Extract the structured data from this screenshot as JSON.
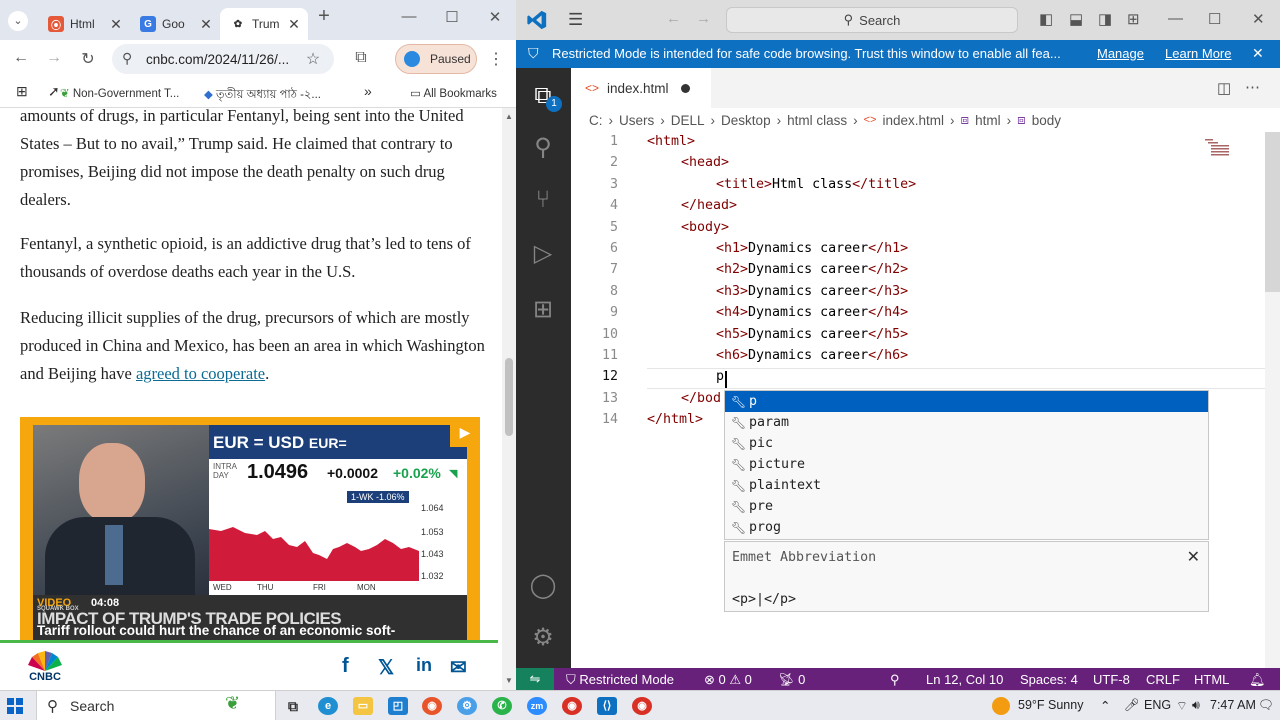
{
  "browser": {
    "tabs": [
      {
        "label": "Html",
        "icon": "chrome-tab-html-icon"
      },
      {
        "label": "Goo",
        "icon": "google-docs-icon"
      },
      {
        "label": "Trum",
        "icon": "cnbc-favicon"
      }
    ],
    "url": "cnbc.com/2024/11/26/...",
    "profile_label": "Paused",
    "bookmarks": [
      {
        "label": "Non-Government T..."
      },
      {
        "label": "তৃতীয় অধ্যায় পাঠ -২..."
      }
    ],
    "all_bookmarks_label": "All Bookmarks",
    "article": {
      "paragraphs": [
        "amounts of drugs, in particular Fentanyl, being sent into the United States – But to no avail,” Trump said. He claimed that contrary to promises, Beijing did not impose the death penalty on such drug dealers.",
        "Fentanyl, a synthetic opioid, is an addictive drug that’s led to tens of thousands of overdose deaths each year in the U.S."
      ],
      "para3_before_link": "Reducing illicit supplies of the drug, precursors of which are mostly produced in China and Mexico, has been an area in which Washington and Beijing have ",
      "para3_link": "agreed to cooperate",
      "para3_after_link": "."
    },
    "video": {
      "ticker": "EUR = USD",
      "ticker_suffix": "EUR=",
      "intraday_label": "INTRA DAY",
      "price": "1.0496",
      "change": "+0.0002",
      "change_pct": "+0.02%",
      "week_label": "1-WK",
      "week_change": "-1.06%",
      "y_ticks": [
        "1.064",
        "1.053",
        "1.043",
        "1.032"
      ],
      "x_ticks": [
        "WED",
        "THU",
        "FRI",
        "MON"
      ],
      "tag": "VIDEO",
      "show": "SQUAWK BOX",
      "time": "04:08",
      "headline": "IMPACT OF TRUMP'S TRADE POLICIES",
      "subtitle": "Tariff rollout could hurt the chance of an economic soft-"
    },
    "share": {
      "logo_text": "CNBC"
    }
  },
  "vscode": {
    "command_center": "Search",
    "restricted_banner": "Restricted Mode is intended for safe code browsing. Trust this window to enable all fea...",
    "manage_label": "Manage",
    "learn_more_label": "Learn More",
    "explorer_badge": "1",
    "tab_label": "index.html",
    "breadcrumbs": [
      "C:",
      "Users",
      "DELL",
      "Desktop",
      "html class",
      "index.html",
      "html",
      "body"
    ],
    "code": {
      "line_numbers": [
        "1",
        "2",
        "3",
        "4",
        "5",
        "6",
        "7",
        "8",
        "9",
        "10",
        "11",
        "12",
        "13",
        "14"
      ],
      "lines": [
        {
          "tag": "<html>",
          "text": ""
        },
        {
          "tag": "<head>",
          "text": ""
        },
        {
          "tag": "<title>",
          "text": "Html class",
          "close": "</title>"
        },
        {
          "tag": "</head>",
          "text": ""
        },
        {
          "tag": "<body>",
          "text": ""
        },
        {
          "tag": "<h1>",
          "text": "Dynamics career",
          "close": "</h1>"
        },
        {
          "tag": "<h2>",
          "text": "Dynamics career",
          "close": "</h2>"
        },
        {
          "tag": "<h3>",
          "text": "Dynamics career",
          "close": "</h3>"
        },
        {
          "tag": "<h4>",
          "text": "Dynamics career",
          "close": "</h4>"
        },
        {
          "tag": "<h5>",
          "text": "Dynamics career",
          "close": "</h5>"
        },
        {
          "tag": "<h6>",
          "text": "Dynamics career",
          "close": "</h6>"
        },
        {
          "tag": "",
          "text": "p"
        },
        {
          "tag": "</bod",
          "text": ""
        },
        {
          "tag": "</html>",
          "text": ""
        }
      ]
    },
    "suggestions": [
      "p",
      "param",
      "pic",
      "picture",
      "plaintext",
      "pre",
      "prog"
    ],
    "detail_title": "Emmet Abbreviation",
    "detail_example": "<p>|</p>",
    "status": {
      "mode": "Restricted Mode",
      "errors": "0",
      "warnings": "0",
      "ports": "0",
      "position": "Ln 12, Col 10",
      "spaces": "Spaces: 4",
      "encoding": "UTF-8",
      "eol": "CRLF",
      "language": "HTML"
    }
  },
  "taskbar": {
    "search_label": "Search",
    "weather": "59°F  Sunny",
    "language": "ENG",
    "time": "7:47 AM"
  },
  "colors": {
    "vscode_blue": "#0e70c0",
    "status_purple": "#68217a",
    "cnbc_orange": "#f6a70d"
  }
}
